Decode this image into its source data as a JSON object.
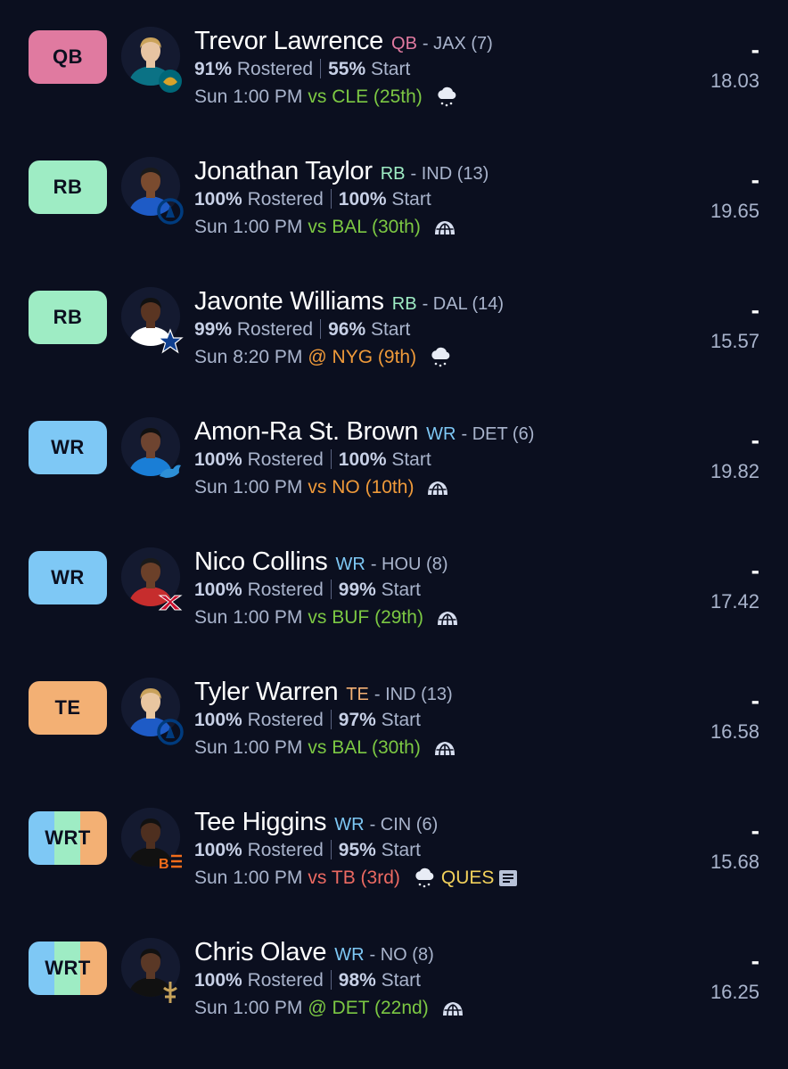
{
  "colors": {
    "background": "#0b0f1f",
    "QB": "#e07aa0",
    "RB": "#9eecc4",
    "WR": "#7ec8f5",
    "TE": "#f3b074",
    "good_matchup": "#7cc843",
    "mid_matchup": "#ef9a3a",
    "bad_matchup": "#ec6a62",
    "ques": "#f2d15b"
  },
  "players": [
    {
      "slot": "QB",
      "name": "Trevor Lawrence",
      "pos": "QB",
      "team_info": "- JAX (7)",
      "rostered_pct": "91%",
      "rostered_label": "Rostered",
      "start_pct": "55%",
      "start_label": "Start",
      "time": "Sun 1:00 PM",
      "opp": "vs CLE (25th)",
      "opp_color": "good",
      "weather_icon": "snow-cloud-icon",
      "proj_dash": "-",
      "proj": "18.03",
      "team_logo": "jaguars-logo"
    },
    {
      "slot": "RB",
      "name": "Jonathan Taylor",
      "pos": "RB",
      "team_info": "- IND (13)",
      "rostered_pct": "100%",
      "rostered_label": "Rostered",
      "start_pct": "100%",
      "start_label": "Start",
      "time": "Sun 1:00 PM",
      "opp": "vs BAL (30th)",
      "opp_color": "good",
      "weather_icon": "dome-icon",
      "proj_dash": "-",
      "proj": "19.65",
      "team_logo": "colts-logo"
    },
    {
      "slot": "RB",
      "name": "Javonte Williams",
      "pos": "RB",
      "team_info": "- DAL (14)",
      "rostered_pct": "99%",
      "rostered_label": "Rostered",
      "start_pct": "96%",
      "start_label": "Start",
      "time": "Sun 8:20 PM",
      "opp": "@ NYG (9th)",
      "opp_color": "mid",
      "weather_icon": "snow-cloud-icon",
      "proj_dash": "-",
      "proj": "15.57",
      "team_logo": "cowboys-logo"
    },
    {
      "slot": "WR",
      "name": "Amon-Ra St. Brown",
      "pos": "WR",
      "team_info": "- DET (6)",
      "rostered_pct": "100%",
      "rostered_label": "Rostered",
      "start_pct": "100%",
      "start_label": "Start",
      "time": "Sun 1:00 PM",
      "opp": "vs NO (10th)",
      "opp_color": "mid",
      "weather_icon": "dome-icon",
      "proj_dash": "-",
      "proj": "19.82",
      "team_logo": "lions-logo"
    },
    {
      "slot": "WR",
      "name": "Nico Collins",
      "pos": "WR",
      "team_info": "- HOU (8)",
      "rostered_pct": "100%",
      "rostered_label": "Rostered",
      "start_pct": "99%",
      "start_label": "Start",
      "time": "Sun 1:00 PM",
      "opp": "vs BUF (29th)",
      "opp_color": "good",
      "weather_icon": "dome-icon",
      "proj_dash": "-",
      "proj": "17.42",
      "team_logo": "texans-logo"
    },
    {
      "slot": "TE",
      "name": "Tyler Warren",
      "pos": "TE",
      "team_info": "- IND (13)",
      "rostered_pct": "100%",
      "rostered_label": "Rostered",
      "start_pct": "97%",
      "start_label": "Start",
      "time": "Sun 1:00 PM",
      "opp": "vs BAL (30th)",
      "opp_color": "good",
      "weather_icon": "dome-icon",
      "proj_dash": "-",
      "proj": "16.58",
      "team_logo": "colts-logo"
    },
    {
      "slot": "WRT",
      "name": "Tee Higgins",
      "pos": "WR",
      "team_info": "- CIN (6)",
      "rostered_pct": "100%",
      "rostered_label": "Rostered",
      "start_pct": "95%",
      "start_label": "Start",
      "time": "Sun 1:00 PM",
      "opp": "vs TB (3rd)",
      "opp_color": "bad",
      "weather_icon": "snow-cloud-icon",
      "status": "QUES",
      "status_icon": "news-icon",
      "proj_dash": "-",
      "proj": "15.68",
      "team_logo": "bengals-logo"
    },
    {
      "slot": "WRT",
      "name": "Chris Olave",
      "pos": "WR",
      "team_info": "- NO (8)",
      "rostered_pct": "100%",
      "rostered_label": "Rostered",
      "start_pct": "98%",
      "start_label": "Start",
      "time": "Sun 1:00 PM",
      "opp": "@ DET (22nd)",
      "opp_color": "good",
      "weather_icon": "dome-icon",
      "proj_dash": "-",
      "proj": "16.25",
      "team_logo": "saints-logo"
    }
  ]
}
